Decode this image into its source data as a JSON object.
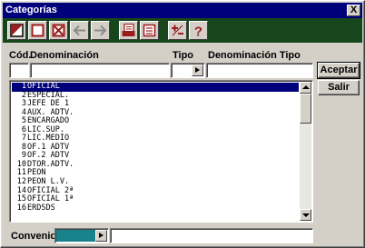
{
  "window": {
    "title": "Categorías",
    "close_label": "X"
  },
  "toolbar": {
    "buttons": [
      {
        "name": "new-record-icon"
      },
      {
        "name": "edit-record-icon"
      },
      {
        "name": "delete-record-icon"
      },
      {
        "name": "arrow-left-icon"
      },
      {
        "name": "arrow-right-icon"
      },
      {
        "name": "print-icon"
      },
      {
        "name": "list-icon"
      },
      {
        "name": "plus-minus-icon"
      },
      {
        "name": "help-icon"
      }
    ],
    "colors": {
      "background": "#17461c"
    }
  },
  "headers": {
    "cod": "Cód.",
    "denominacion": "Denominación",
    "tipo": "Tipo",
    "denominacion_tipo": "Denominación Tipo"
  },
  "inputs": {
    "cod": "",
    "denominacion": "",
    "tipo": "",
    "denominacion_tipo": ""
  },
  "buttons": {
    "aceptar": "Aceptar",
    "salir": "Salir"
  },
  "list": {
    "selected_index": 0,
    "items": [
      {
        "num": "1",
        "text": "OFICIAL"
      },
      {
        "num": "2",
        "text": "ESPECIAL."
      },
      {
        "num": "3",
        "text": "JEFE DE 1"
      },
      {
        "num": "4",
        "text": "AUX. ADTV."
      },
      {
        "num": "5",
        "text": "ENCARGADO"
      },
      {
        "num": "6",
        "text": "LIC.SUP."
      },
      {
        "num": "7",
        "text": "LIC.MEDIO"
      },
      {
        "num": "8",
        "text": "OF.1 ADTV"
      },
      {
        "num": "9",
        "text": "OF.2 ADTV"
      },
      {
        "num": "10",
        "text": "DTOR.ADTV."
      },
      {
        "num": "11",
        "text": "PEON"
      },
      {
        "num": "12",
        "text": "PEON L.V."
      },
      {
        "num": "14",
        "text": "OFICIAL 2ª"
      },
      {
        "num": "15",
        "text": "OFICIAL 1ª"
      },
      {
        "num": "16",
        "text": "ERDSDS"
      }
    ]
  },
  "convenio": {
    "label": "Convenio",
    "value_color": "#17828a",
    "value": "",
    "description": ""
  },
  "colors": {
    "title_bar": "#00007b",
    "selection": "#00007b"
  }
}
